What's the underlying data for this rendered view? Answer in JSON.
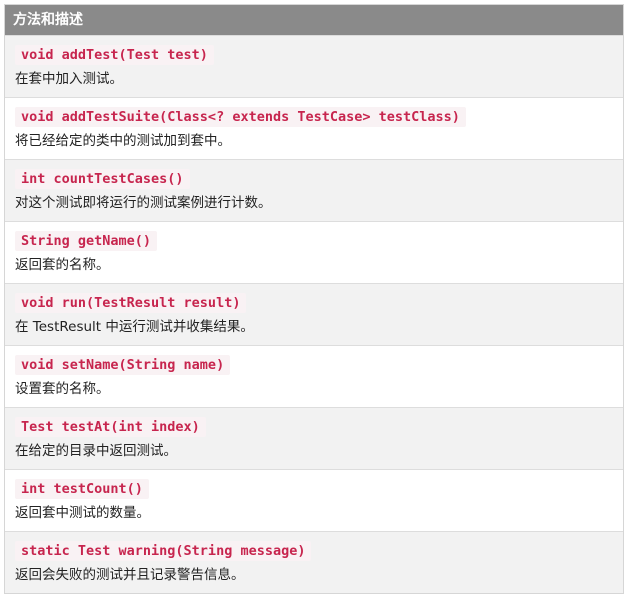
{
  "table": {
    "header": "方法和描述",
    "rows": [
      {
        "signature": "void addTest(Test test)",
        "description": "在套中加入测试。"
      },
      {
        "signature": "void addTestSuite(Class<? extends TestCase> testClass)",
        "description": "将已经给定的类中的测试加到套中。"
      },
      {
        "signature": "int countTestCases()",
        "description": "对这个测试即将运行的测试案例进行计数。"
      },
      {
        "signature": "String getName()",
        "description": "返回套的名称。"
      },
      {
        "signature": "void run(TestResult result)",
        "description": "在 TestResult 中运行测试并收集结果。"
      },
      {
        "signature": "void setName(String name)",
        "description": "设置套的名称。"
      },
      {
        "signature": "Test testAt(int index)",
        "description": "在给定的目录中返回测试。"
      },
      {
        "signature": "int testCount()",
        "description": "返回套中测试的数量。"
      },
      {
        "signature": "static Test warning(String message)",
        "description": "返回会失败的测试并且记录警告信息。"
      }
    ]
  }
}
